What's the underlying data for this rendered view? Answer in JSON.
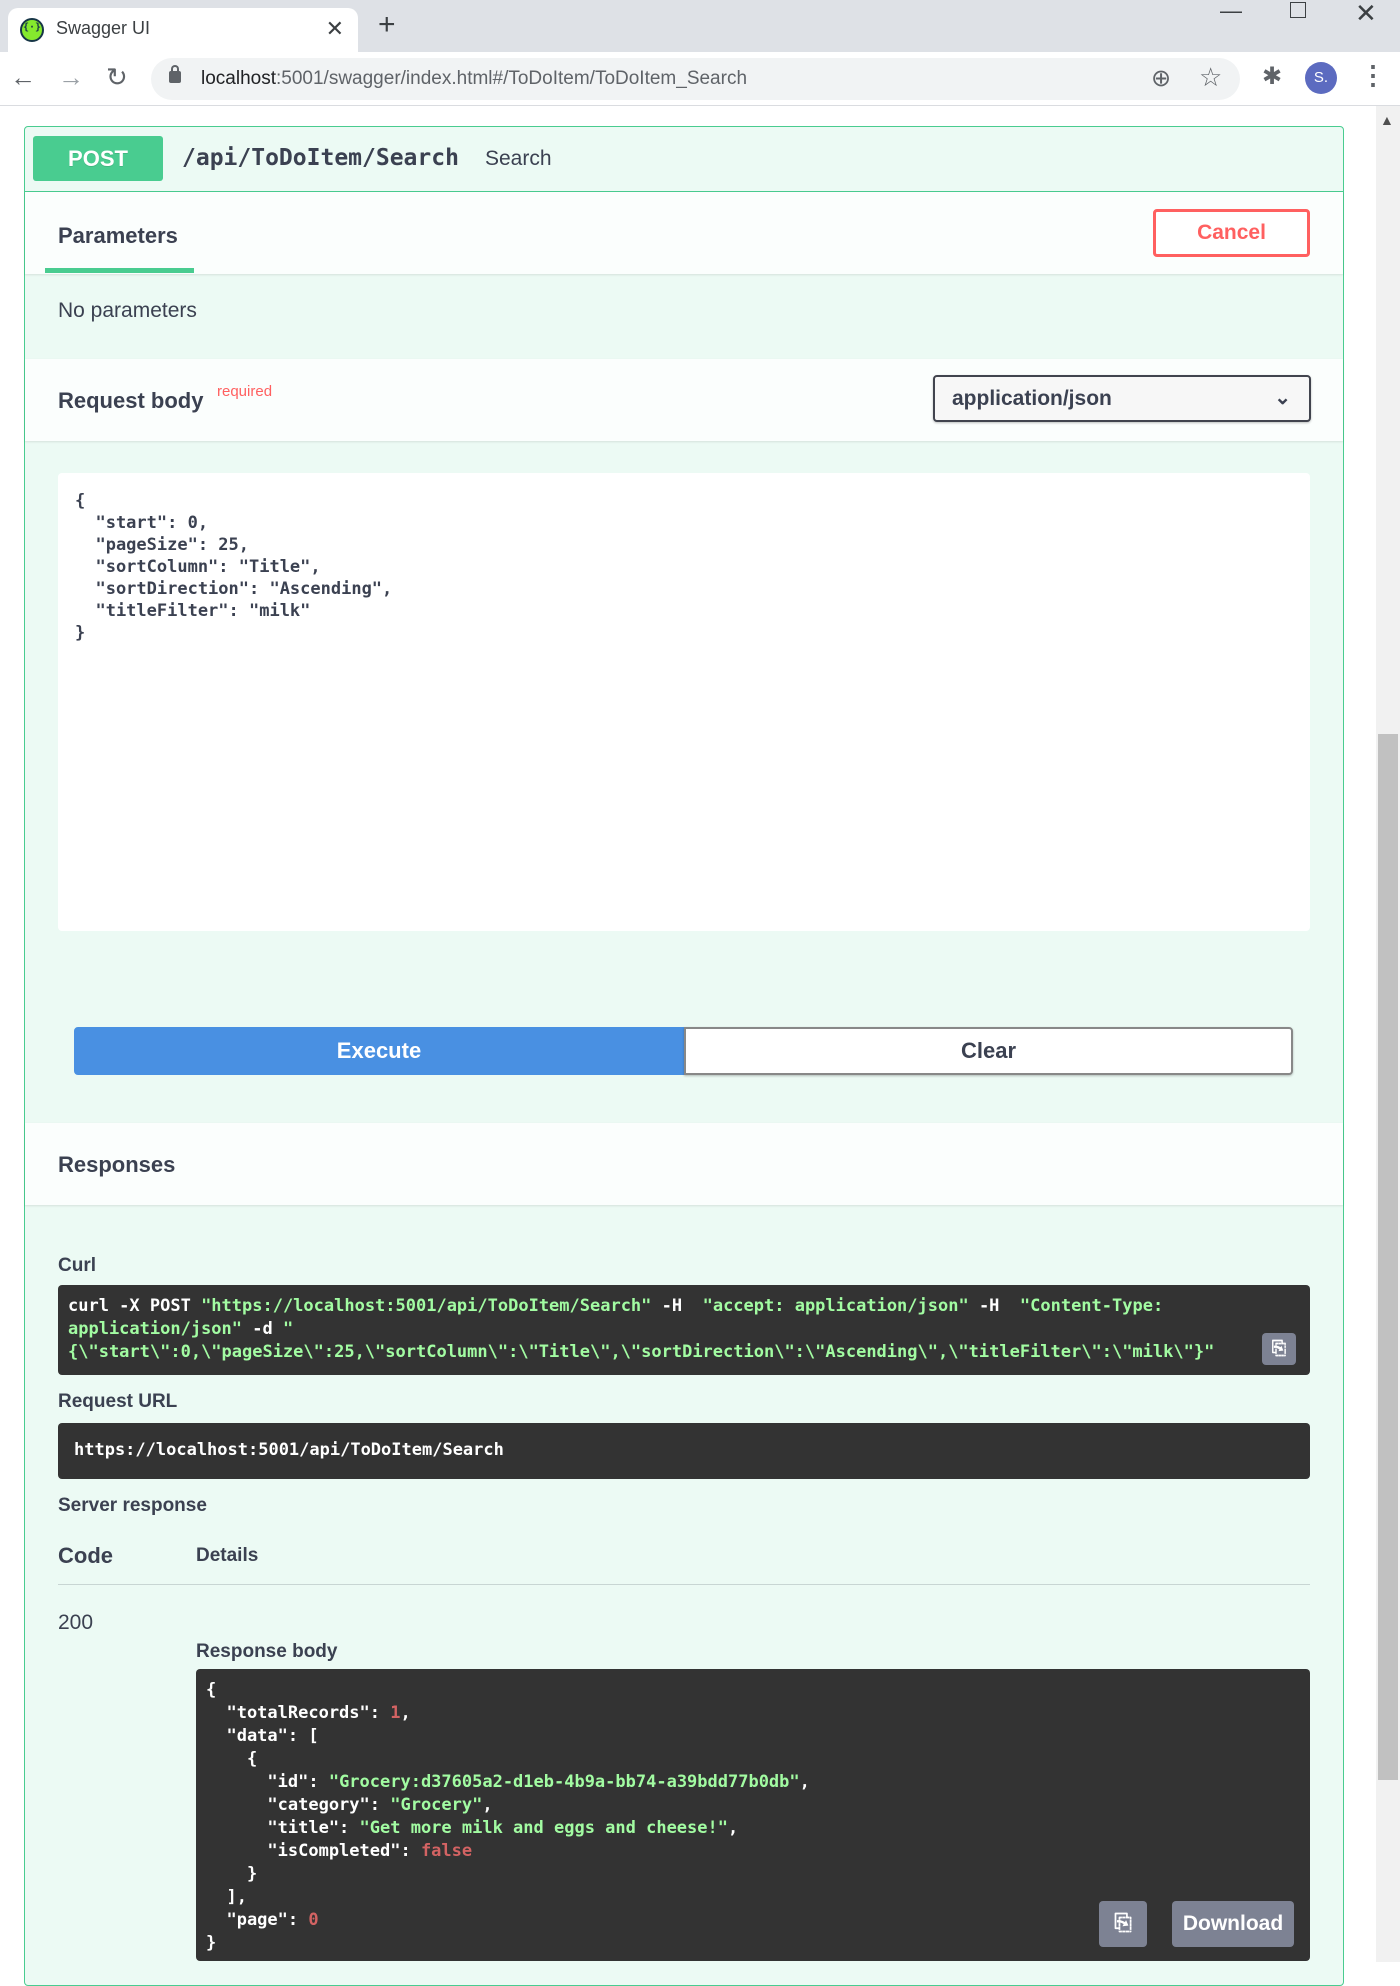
{
  "browser": {
    "tab_title": "Swagger UI",
    "url_host": "localhost",
    "url_path": ":5001/swagger/index.html#/ToDoItem/ToDoItem_Search",
    "profile_initial": "S."
  },
  "operation": {
    "method": "POST",
    "path": "/api/ToDoItem/Search",
    "description": "Search"
  },
  "parameters": {
    "title": "Parameters",
    "cancel_label": "Cancel",
    "empty_text": "No parameters"
  },
  "request_body": {
    "title": "Request body",
    "required_label": "required",
    "content_type": "application/json",
    "body_text": "{\n  \"start\": 0,\n  \"pageSize\": 25,\n  \"sortColumn\": \"Title\",\n  \"sortDirection\": \"Ascending\",\n  \"titleFilter\": \"milk\"\n}"
  },
  "actions": {
    "execute_label": "Execute",
    "clear_label": "Clear"
  },
  "responses": {
    "title": "Responses",
    "curl_label": "Curl",
    "request_url_label": "Request URL",
    "request_url": "https://localhost:5001/api/ToDoItem/Search",
    "server_response_label": "Server response",
    "code_header": "Code",
    "details_header": "Details",
    "status_code": "200",
    "response_body_label": "Response body",
    "download_label": "Download"
  },
  "icons": {
    "copy": "clipboard-icon",
    "select": "chevron-down-icon"
  },
  "colors": {
    "post_green": "#49cc90",
    "execute_blue": "#4990e2",
    "cancel_red": "#ff6060",
    "code_bg": "#333333",
    "code_string": "#a2fca2",
    "code_number": "#d36363"
  }
}
